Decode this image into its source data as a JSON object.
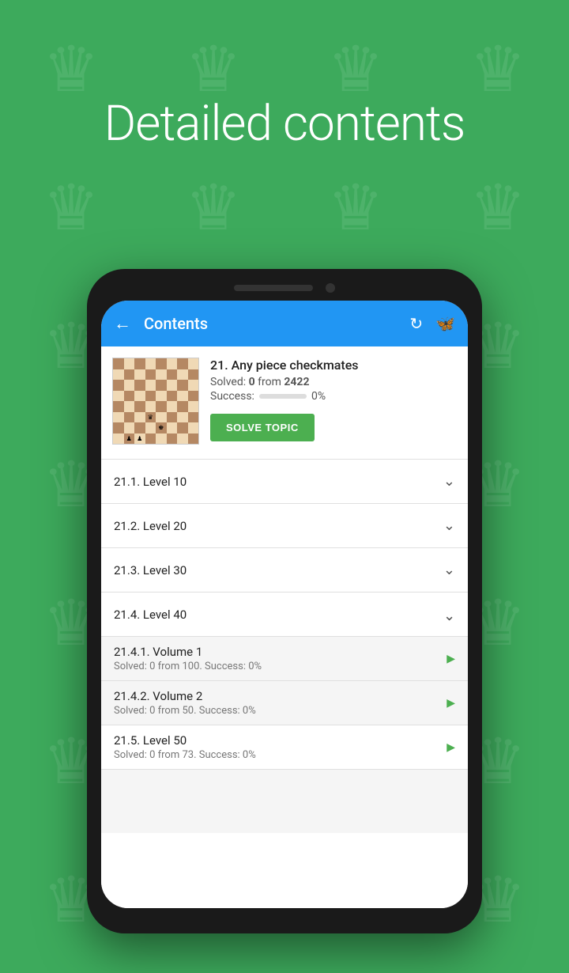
{
  "page": {
    "title": "Detailed contents",
    "background_color": "#3daa5c"
  },
  "app_bar": {
    "title": "Contents",
    "back_label": "←",
    "icon_refresh": "↻",
    "icon_butterfly": "🦋"
  },
  "topic": {
    "number": "21.",
    "name": "Any piece checkmates",
    "full_title": "21. Any piece checkmates",
    "solved_label": "Solved:",
    "solved_count": "0",
    "solved_from": "from",
    "solved_total": "2422",
    "success_label": "Success:",
    "success_percent": "0%",
    "progress": 0,
    "solve_button": "SOLVE TOPIC"
  },
  "levels": [
    {
      "id": "21.1",
      "label": "21.1. Level 10",
      "expanded": false
    },
    {
      "id": "21.2",
      "label": "21.2. Level 20",
      "expanded": false
    },
    {
      "id": "21.3",
      "label": "21.3. Level 30",
      "expanded": false
    },
    {
      "id": "21.4",
      "label": "21.4. Level 40",
      "expanded": true
    }
  ],
  "sub_items": [
    {
      "id": "21.4.1",
      "title": "21.4.1. Volume 1",
      "desc": "Solved: 0 from 100. Success: 0%"
    },
    {
      "id": "21.4.2",
      "title": "21.4.2. Volume 2",
      "desc": "Solved: 0 from 50. Success: 0%"
    }
  ],
  "level_50": {
    "title": "21.5. Level 50",
    "desc": "Solved: 0 from 73. Success: 0%"
  },
  "chess_board": {
    "pieces": {
      "d3": "♛",
      "e2": "♚",
      "b1": "♟",
      "c1": "♟"
    }
  }
}
